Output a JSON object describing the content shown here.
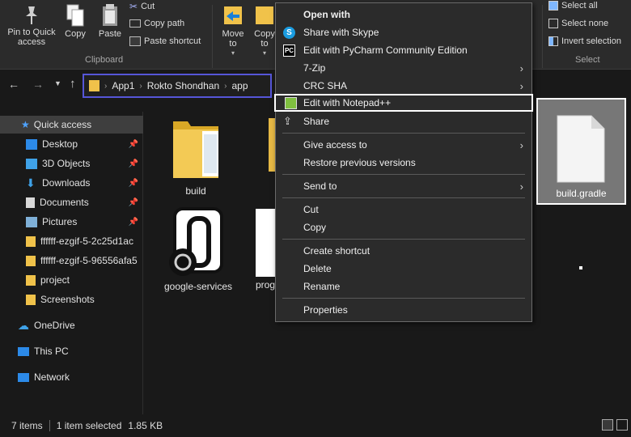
{
  "ribbon": {
    "pin_quick_access": "Pin to Quick access",
    "copy": "Copy",
    "paste": "Paste",
    "cut": "Cut",
    "copy_path": "Copy path",
    "paste_shortcut": "Paste shortcut",
    "clipboard_group": "Clipboard",
    "move_to": "Move to",
    "copy_to": "Copy to",
    "select_all": "Select all",
    "select_none": "Select none",
    "invert_selection": "Invert selection",
    "select_group": "Select"
  },
  "address": {
    "crumbs": [
      "App1",
      "Rokto Shondhan",
      "app"
    ]
  },
  "navpane": {
    "quick_access": "Quick access",
    "items": [
      "Desktop",
      "3D Objects",
      "Downloads",
      "Documents",
      "Pictures",
      "ffffff-ezgif-5-2c25d1ac",
      "ffffff-ezgif-5-96556afa5",
      "project",
      "Screenshots"
    ],
    "onedrive": "OneDrive",
    "this_pc": "This PC",
    "network": "Network"
  },
  "files": {
    "build": "build",
    "google_services": "google-services",
    "proguard": "prog",
    "build_gradle": "build.gradle"
  },
  "context_menu": {
    "open_with": "Open with",
    "share_skype": "Share with Skype",
    "pycharm": "Edit with PyCharm Community Edition",
    "zip": "7-Zip",
    "crc_sha": "CRC SHA",
    "notepadpp": "Edit with Notepad++",
    "share": "Share",
    "give_access": "Give access to",
    "restore": "Restore previous versions",
    "send_to": "Send to",
    "cut": "Cut",
    "copy": "Copy",
    "create_shortcut": "Create shortcut",
    "delete": "Delete",
    "rename": "Rename",
    "properties": "Properties"
  },
  "status": {
    "items": "7 items",
    "selected": "1 item selected",
    "size": "1.85 KB"
  },
  "colors": {
    "accent_address_border": "#5656d8",
    "folder": "#f0c24a",
    "skype": "#1a9ce0"
  }
}
